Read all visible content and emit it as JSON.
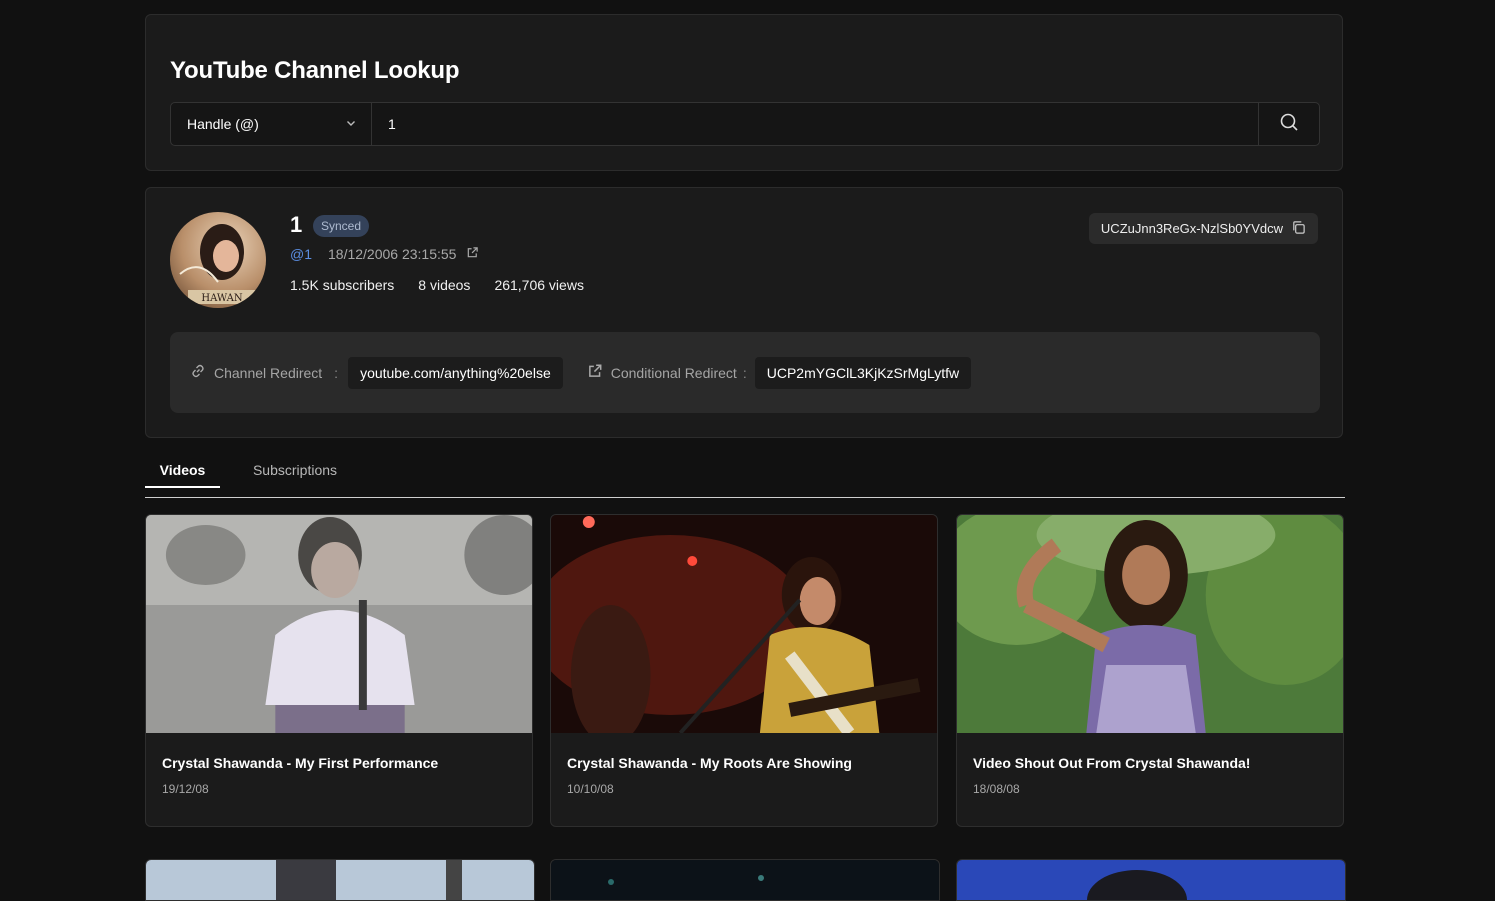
{
  "lookup": {
    "title": "YouTube Channel Lookup",
    "type_select": "Handle (@)",
    "query_value": "1"
  },
  "channel": {
    "name": "1",
    "status_badge": "Synced",
    "handle": "@1",
    "created": "18/12/2006 23:15:55",
    "subscribers": "1.5K subscribers",
    "videos": "8 videos",
    "views": "261,706 views",
    "channel_id": "UCZuJnn3ReGx-NzlSb0YVdcw",
    "avatar_text": "HAWAN"
  },
  "redirects": {
    "channel_label": "Channel Redirect",
    "channel_value": "youtube.com/anything%20else",
    "conditional_label": "Conditional Redirect",
    "conditional_value": "UCP2mYGClL3KjKzSrMgLytfw",
    "separator": ":"
  },
  "tabs": [
    {
      "label": "Videos",
      "active": true
    },
    {
      "label": "Subscriptions",
      "active": false
    }
  ],
  "videos": [
    {
      "title": "Crystal Shawanda - My First Performance",
      "date": "19/12/08"
    },
    {
      "title": "Crystal Shawanda - My Roots Are Showing",
      "date": "10/10/08"
    },
    {
      "title": "Video Shout Out From Crystal Shawanda!",
      "date": "18/08/08"
    }
  ],
  "colors": {
    "background": "#111111",
    "panel": "#1b1b1b",
    "accent_link": "#5b8de0",
    "badge_bg": "#34425a"
  },
  "icons": [
    "chevron-down-icon",
    "search-icon",
    "external-link-icon",
    "copy-icon",
    "link-icon"
  ]
}
